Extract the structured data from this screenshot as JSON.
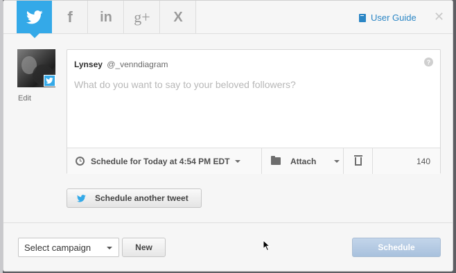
{
  "tabs": [
    {
      "name": "twitter",
      "icon": "twitter-bird",
      "active": true
    },
    {
      "name": "facebook",
      "glyph": "f",
      "active": false
    },
    {
      "name": "linkedin",
      "glyph": "in",
      "active": false
    },
    {
      "name": "google-plus",
      "glyph": "g+",
      "active": false
    },
    {
      "name": "xing",
      "glyph": "X",
      "active": false
    }
  ],
  "header": {
    "user_guide_label": "User Guide",
    "close_glyph": "✕"
  },
  "profile": {
    "edit_label": "Edit"
  },
  "composer": {
    "display_name": "Lynsey",
    "handle": "@_venndiagram",
    "help_glyph": "?",
    "placeholder": "What do you want to say to your beloved followers?",
    "value": ""
  },
  "composer_bar": {
    "schedule_label": "Schedule for Today at 4:54 PM EDT",
    "attach_label": "Attach",
    "char_count": "140"
  },
  "another_tweet_label": "Schedule another tweet",
  "footer": {
    "campaign_select_value": "Select campaign",
    "new_label": "New",
    "schedule_label": "Schedule"
  },
  "colors": {
    "twitter_blue": "#34a9e8",
    "link_blue": "#2b86c5",
    "schedule_button": "#b5cbe3"
  }
}
